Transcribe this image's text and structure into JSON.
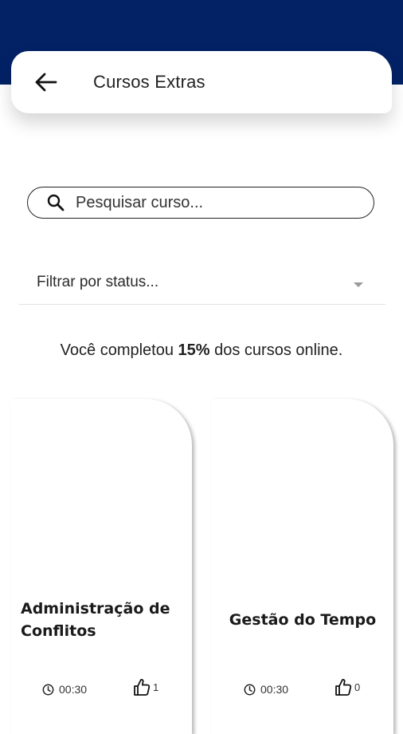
{
  "header": {
    "title": "Cursos Extras"
  },
  "search": {
    "placeholder": "Pesquisar curso...",
    "value": ""
  },
  "filter": {
    "placeholder": "Filtrar por status..."
  },
  "progress": {
    "prefix": "Você completou ",
    "percent": "15%",
    "suffix": " dos cursos online."
  },
  "courses": [
    {
      "title": "Administração de Conflitos",
      "duration": "00:30",
      "likes": "1"
    },
    {
      "title": "Gestão do Tempo",
      "duration": "00:30",
      "likes": "0"
    }
  ],
  "colors": {
    "topbar": "#032266",
    "card": "#ffffff",
    "text": "#1a1a1a"
  },
  "icons": {
    "back": "arrow-left-icon",
    "search": "search-icon",
    "dropdown": "caret-down-icon",
    "duration": "clock-icon",
    "like": "thumbs-up-icon"
  }
}
